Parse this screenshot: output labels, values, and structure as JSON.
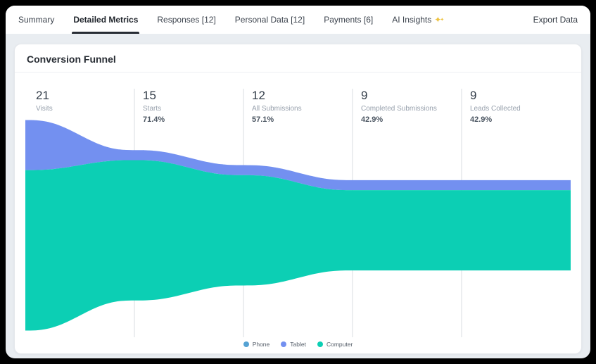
{
  "tabs": {
    "items": [
      {
        "label": "Summary",
        "active": false
      },
      {
        "label": "Detailed Metrics",
        "active": true
      },
      {
        "label": "Responses [12]",
        "active": false
      },
      {
        "label": "Personal Data [12]",
        "active": false
      },
      {
        "label": "Payments [6]",
        "active": false
      },
      {
        "label": "AI Insights",
        "active": false,
        "icon": "sparkle"
      }
    ],
    "export_label": "Export Data"
  },
  "card": {
    "title": "Conversion Funnel"
  },
  "chart_data": {
    "type": "area",
    "variant": "stacked-stream-funnel",
    "title": "Conversion Funnel",
    "stages": [
      {
        "value": "21",
        "label": "Visits"
      },
      {
        "value": "15",
        "label": "Starts",
        "percent": "71.4%"
      },
      {
        "value": "12",
        "label": "All Submissions",
        "percent": "57.1%"
      },
      {
        "value": "9",
        "label": "Completed Submissions",
        "percent": "42.9%"
      },
      {
        "value": "9",
        "label": "Leads Collected",
        "percent": "42.9%"
      }
    ],
    "series": [
      {
        "name": "Phone",
        "color": "#55a2d3",
        "values": [
          0,
          0,
          0,
          0,
          0
        ]
      },
      {
        "name": "Tablet",
        "color": "#7390f0",
        "values": [
          5,
          1,
          1,
          1,
          1
        ]
      },
      {
        "name": "Computer",
        "color": "#0ccfb4",
        "values": [
          16,
          14,
          11,
          8,
          8
        ]
      }
    ],
    "legend_position": "bottom",
    "grid": "vertical-stage-lines",
    "gridline_color": "#d8dce2",
    "colors": {
      "sparkle": "#eec23e",
      "active_tab_underline": "#272c34"
    }
  }
}
